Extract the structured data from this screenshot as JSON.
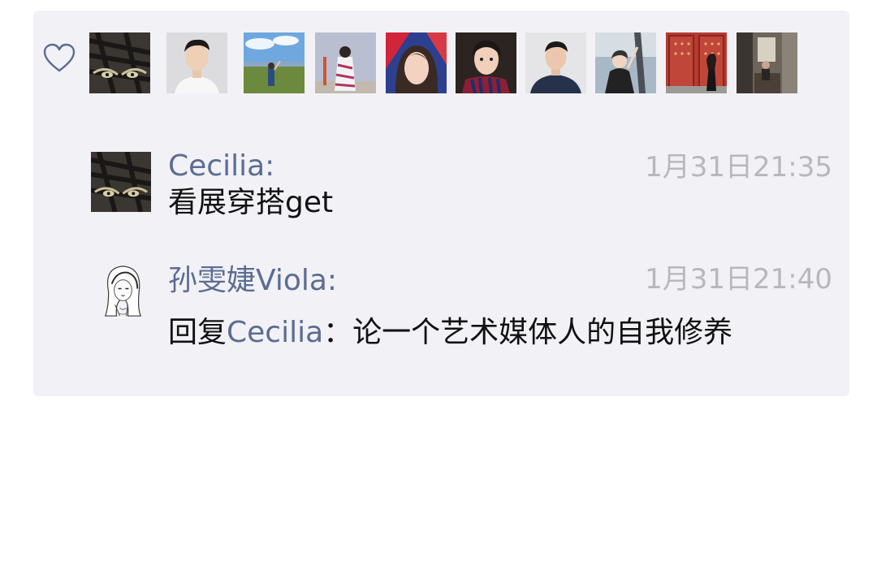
{
  "moments": {
    "likes": {
      "icon": "heart-outline-icon",
      "avatars": [
        {
          "name": "tiger-avatar"
        },
        {
          "name": "man-white-shirt-avatar"
        },
        {
          "name": "landscape-avatar"
        },
        {
          "name": "kimono-avatar"
        },
        {
          "name": "girl-selfie-avatar"
        },
        {
          "name": "girl-jersey-avatar"
        },
        {
          "name": "man-dark-shirt-avatar"
        },
        {
          "name": "girl-dress-avatar"
        },
        {
          "name": "red-door-avatar"
        },
        {
          "name": "interior-avatar"
        }
      ]
    },
    "comments": [
      {
        "author": "Cecilia:",
        "time": "1月31日21:35",
        "text": "看展穿搭get"
      },
      {
        "author": "孙雯婕Viola:",
        "time": "1月31日21:40",
        "reply_prefix": "回复",
        "reply_to": "Cecilia",
        "text": "：论一个艺术媒体人的自我修养"
      }
    ]
  },
  "colors": {
    "name": "#5b6d92",
    "time": "#b7b7bc",
    "panel_bg": "#f2f1f6"
  }
}
